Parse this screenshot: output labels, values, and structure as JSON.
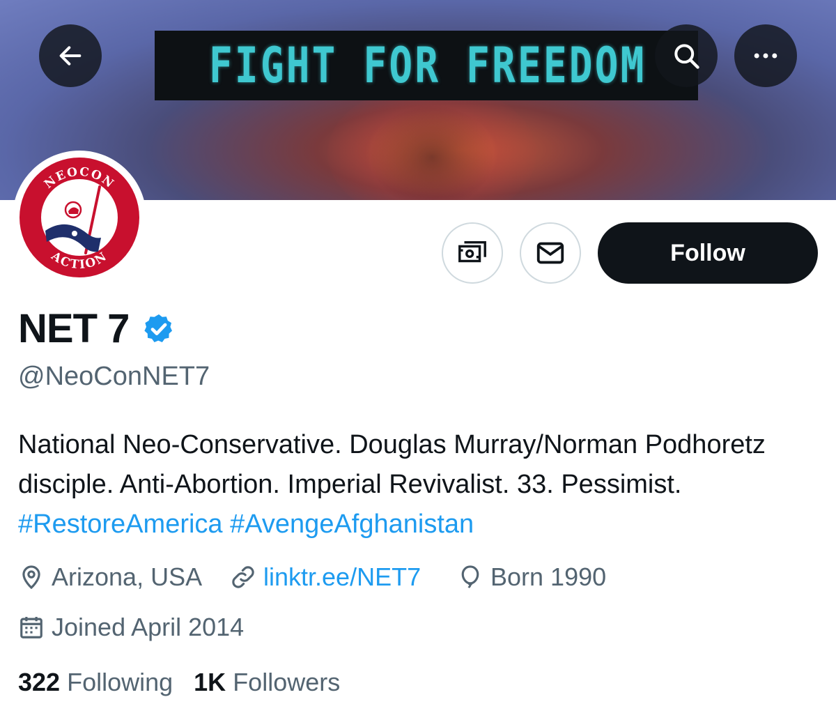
{
  "banner": {
    "sign_text": "FIGHT FOR FREEDOM"
  },
  "nav": {
    "back_icon": "arrow-left-icon",
    "search_icon": "search-icon",
    "more_icon": "more-horizontal-icon"
  },
  "avatar": {
    "top_text": "NEOCON",
    "bottom_text": "ACTION",
    "ring_color": "#c8102e"
  },
  "actions": {
    "tip_icon": "money-icon",
    "message_icon": "envelope-icon",
    "follow_label": "Follow"
  },
  "profile": {
    "display_name": "NET 7",
    "verified_icon": "verified-badge-icon",
    "handle": "@NeoConNET7",
    "bio_text": "National Neo-Conservative. Douglas Murray/Norman Podhoretz disciple. Anti-Abortion. Imperial Revivalist. 33. Pessimist. ",
    "hashtags": [
      "#RestoreAmerica",
      "#AvengeAfghanistan"
    ],
    "location": "Arizona, USA",
    "link": "linktr.ee/NET7",
    "born": "Born 1990",
    "joined": "Joined April 2014"
  },
  "stats": {
    "following_count": "322",
    "following_label": "Following",
    "followers_count": "1K",
    "followers_label": "Followers"
  },
  "colors": {
    "accent": "#1d9bf0",
    "text_primary": "#0f1419",
    "text_secondary": "#536471",
    "border": "#cfd9de"
  }
}
